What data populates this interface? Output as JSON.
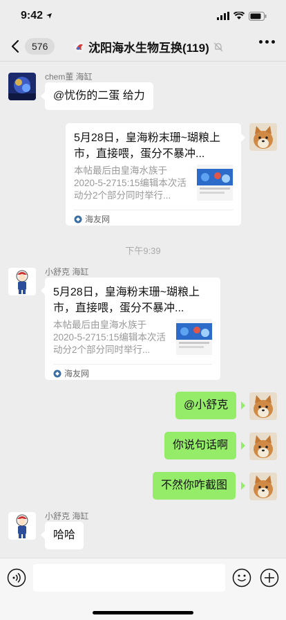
{
  "status_bar": {
    "time": "9:42"
  },
  "header": {
    "back_count": "576",
    "title": "沈阳海水生物互换(119)"
  },
  "messages": {
    "m1": {
      "sender": "chem董 海缸",
      "text": "@忧伤的二蛋 给力"
    },
    "m2": {
      "title": "5月28日，皇海粉末珊~瑚粮上市，直接喂，蛋分不暴冲...",
      "desc": "本帖最后由皇海水族于2020-5-2715:15编辑本次活动分2个部分同时举行...",
      "source": "海友网"
    },
    "timestamp": "下午9:39",
    "m3": {
      "sender": "小舒克 海缸",
      "title": "5月28日，皇海粉末珊~瑚粮上市，直接喂，蛋分不暴冲...",
      "desc": "本帖最后由皇海水族于2020-5-2715:15编辑本次活动分2个部分同时举行...",
      "source": "海友网"
    },
    "m4": {
      "text": "@小舒克"
    },
    "m5": {
      "text": "你说句话啊"
    },
    "m6": {
      "text": "不然你咋截图"
    },
    "m7": {
      "sender": "小舒克 海缸",
      "text": "哈哈"
    }
  },
  "input": {
    "placeholder": ""
  },
  "colors": {
    "background": "#ededed",
    "bubble_green": "#95ec69",
    "bubble_white": "#ffffff"
  },
  "icons": [
    "signal-icon",
    "wifi-icon",
    "battery-icon",
    "chevron-left-icon",
    "mute-icon",
    "more-icon",
    "voice-icon",
    "emoji-icon",
    "plus-icon",
    "link-source-icon"
  ]
}
